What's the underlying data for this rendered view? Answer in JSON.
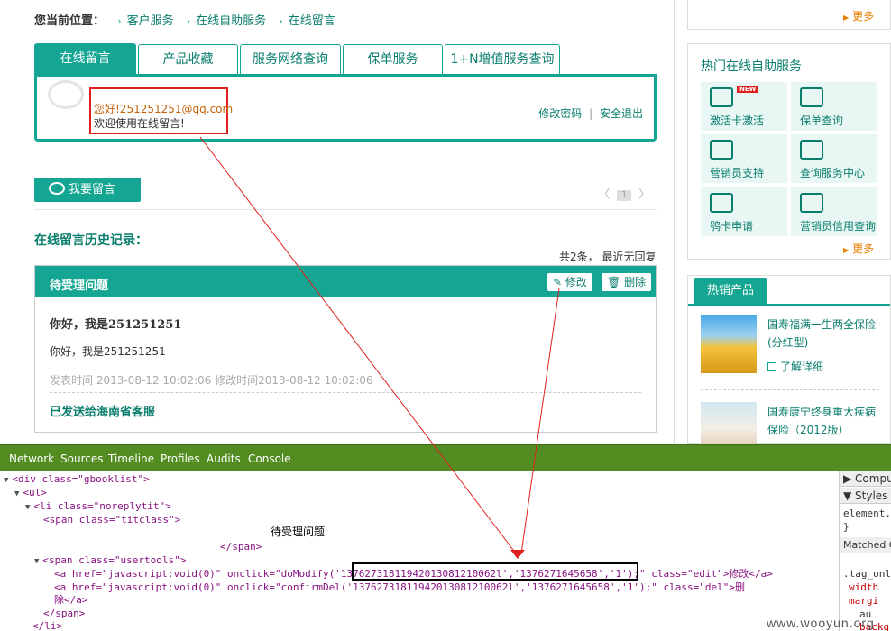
{
  "breadcrumb": {
    "label": "您当前位置：",
    "items": [
      "客户服务",
      "在线自助服务",
      "在线留言"
    ]
  },
  "tabs": [
    "在线留言",
    "产品收藏",
    "服务网络查询",
    "保单服务",
    "1+N增值服务查询"
  ],
  "welcome": {
    "user": "您好!251251251@qq.com",
    "message": "欢迎使用在线留言!",
    "change_password": "修改密码",
    "divider": "|",
    "logout": "安全退出"
  },
  "leave_message_button": "我要留言",
  "pager": {
    "prev": "〈",
    "page": "1",
    "next": "〉"
  },
  "history": {
    "title": "在线留言历史记录：",
    "count_text": "共2条， 最近无回复"
  },
  "card": {
    "title": "待受理问题",
    "edit": "修改",
    "delete": "删除",
    "question_title": "你好，我是251251251",
    "question_body": "你好，我是251251251",
    "meta": "发表时间 2013-08-12 10:02:06    修改时间2013-08-12 10:02:06",
    "status": "已发送给海南省客服"
  },
  "sidebar": {
    "more": "更多",
    "services_title": "热门在线自助服务",
    "new_badge": "NEW",
    "services": [
      "激活卡激活",
      "保单查询",
      "营销员支持",
      "查询服务中心",
      "鸮卡申请",
      "营销员信用查询"
    ],
    "services_more": "更多",
    "products_tab": "热销产品",
    "products": [
      {
        "name": "国寿福满一生两全保险(分红型)",
        "detail": "了解详细"
      },
      {
        "name": "国寿康宁终身重大疾病保险（2012版）"
      }
    ]
  },
  "devtools": {
    "tabs": [
      "Network",
      "Sources",
      "Timeline",
      "Profiles",
      "Audits",
      "Console"
    ],
    "lines": [
      "<div class=\"gbooklist\">",
      "<ul>",
      "<li class=\"noreplytit\">",
      "<span class=\"titclass\">",
      "待受理问题",
      "</span>",
      "<span class=\"usertools\">",
      "<a href=\"javascript:void(0)\" onclick=\"doModify('13762731811942013081210062l','1376271645658','1');\" class=\"edit\">修改</a>",
      "<a href=\"javascript:void(0)\" onclick=\"confirmDel('13762731811942013081210062l','1376271645658','1');\" class=\"del\">删",
      "除</a>",
      "</span>",
      "</li>"
    ],
    "side": [
      "Compu",
      "Styles",
      "element.",
      "}",
      "Matched C",
      ".tag_onl",
      "width",
      "margi",
      "au",
      "backg"
    ]
  },
  "watermark": "www.wooyun.org",
  "colors": {
    "teal": "#14a692",
    "dark_teal": "#0a7e6d",
    "orange": "#e67e00",
    "red": "#e0201f",
    "devtools_green": "#538d22"
  }
}
